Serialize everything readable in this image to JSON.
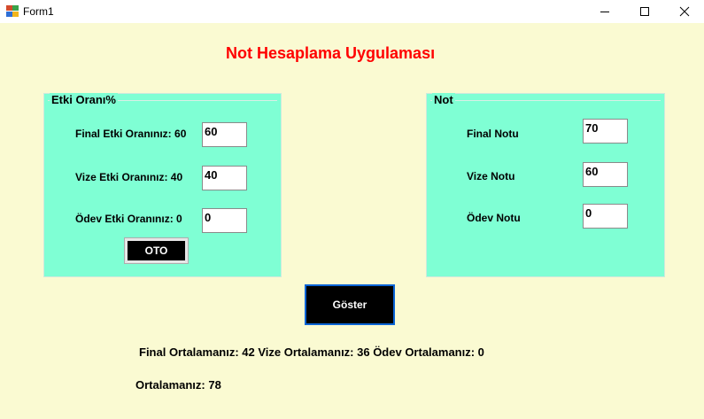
{
  "window": {
    "title": "Form1"
  },
  "heading": "Not Hesaplama Uygulaması",
  "etki_group": {
    "title": "Etki Oranı%",
    "rows": [
      {
        "label": "Final Etki Oranınız: 60",
        "value": "60"
      },
      {
        "label": "Vize Etki Oranınız: 40",
        "value": "40"
      },
      {
        "label": "Ödev Etki Oranınız: 0",
        "value": "0"
      }
    ],
    "oto_button": "OTO"
  },
  "not_group": {
    "title": "Not",
    "rows": [
      {
        "label": "Final Notu",
        "value": "70"
      },
      {
        "label": "Vize Notu",
        "value": "60"
      },
      {
        "label": "Ödev Notu",
        "value": "0"
      }
    ]
  },
  "goster_button": "Göster",
  "results": {
    "ortalamalar": "Final Ortalamanız: 42 Vize Ortalamanız: 36 Ödev Ortalamanız: 0",
    "ortalama": "Ortalamanız: 78"
  },
  "colors": {
    "background": "#fafad2",
    "group_background": "#7fffd4",
    "heading": "#ff0000",
    "button_background": "#000000",
    "button_focus_border": "#0a64d6"
  }
}
